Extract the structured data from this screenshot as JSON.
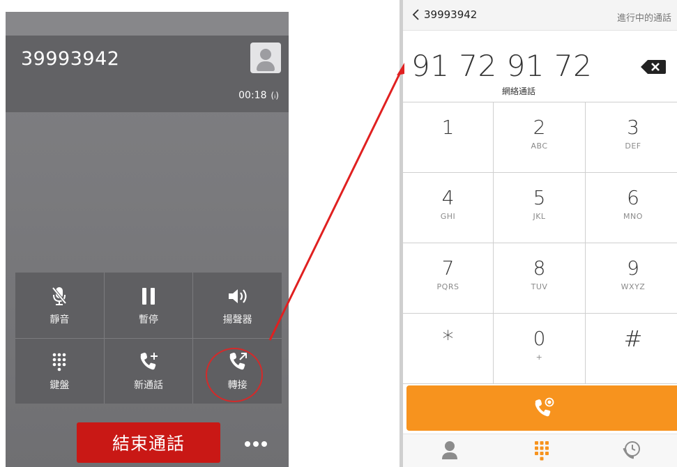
{
  "in_call": {
    "caller_number": "39993942",
    "call_timer": "00:18",
    "signal_glyph": "(ᵢ)",
    "controls": [
      {
        "key": "mute",
        "label": "靜音",
        "icon": "mic-off-icon"
      },
      {
        "key": "pause",
        "label": "暫停",
        "icon": "pause-icon"
      },
      {
        "key": "speaker",
        "label": "揚聲器",
        "icon": "speaker-icon"
      },
      {
        "key": "keypad",
        "label": "鍵盤",
        "icon": "keypad-icon"
      },
      {
        "key": "new_call",
        "label": "新通話",
        "icon": "add-call-icon"
      },
      {
        "key": "transfer",
        "label": "轉接",
        "icon": "transfer-call-icon"
      }
    ],
    "end_call_label": "結束通話"
  },
  "dialer": {
    "back_number": "39993942",
    "status_text": "進行中的通話",
    "dialed_number": "91 72 91 72",
    "subtitle": "網絡通話",
    "keys": [
      {
        "digit": "1",
        "letters": ""
      },
      {
        "digit": "2",
        "letters": "ABC"
      },
      {
        "digit": "3",
        "letters": "DEF"
      },
      {
        "digit": "4",
        "letters": "GHI"
      },
      {
        "digit": "5",
        "letters": "JKL"
      },
      {
        "digit": "6",
        "letters": "MNO"
      },
      {
        "digit": "7",
        "letters": "PQRS"
      },
      {
        "digit": "8",
        "letters": "TUV"
      },
      {
        "digit": "9",
        "letters": "WXYZ"
      },
      {
        "digit": "*",
        "letters": ""
      },
      {
        "digit": "0",
        "letters": "+"
      },
      {
        "digit": "#",
        "letters": ""
      }
    ],
    "tabs": [
      {
        "icon": "contacts-icon"
      },
      {
        "icon": "keypad-icon"
      },
      {
        "icon": "recent-calls-icon"
      }
    ]
  },
  "colors": {
    "end_call": "#c91815",
    "call_button": "#f7931e",
    "annotation": "#e02020"
  }
}
